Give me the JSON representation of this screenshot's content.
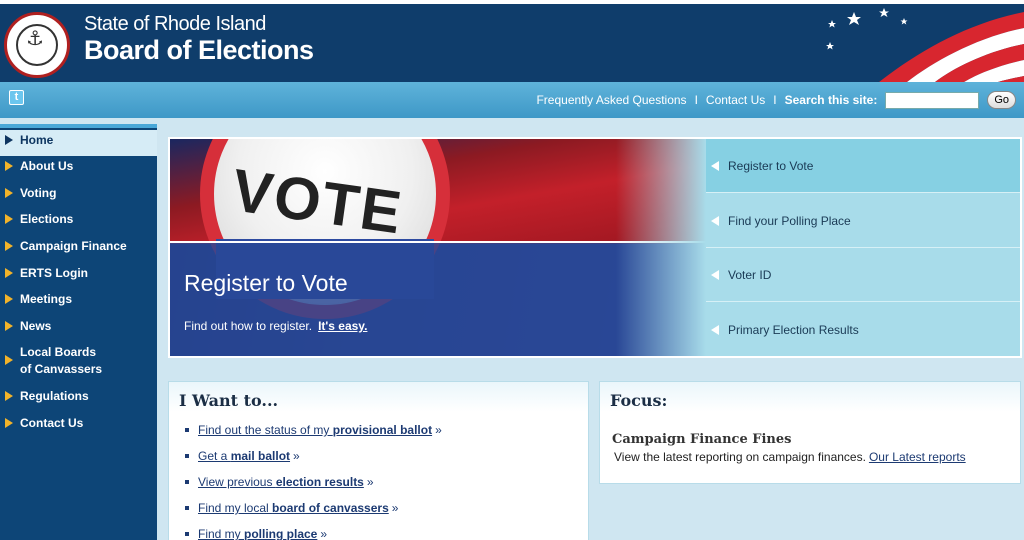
{
  "header": {
    "title_line1": "State of Rhode Island",
    "title_line2": "Board of Elections",
    "seal_icon": "state-seal-icon"
  },
  "utility_bar": {
    "twitter_icon": "twitter-icon",
    "faq_label": "Frequently Asked Questions",
    "contact_label": "Contact Us",
    "separator": "I",
    "search_label": "Search this site:",
    "search_value": "",
    "go_label": "Go"
  },
  "sidebar": {
    "items": [
      {
        "label": "Home",
        "active": true
      },
      {
        "label": "About Us"
      },
      {
        "label": "Voting"
      },
      {
        "label": "Elections"
      },
      {
        "label": "Campaign Finance"
      },
      {
        "label": "ERTS Login"
      },
      {
        "label": "Meetings"
      },
      {
        "label": "News"
      },
      {
        "label": "Local Boards of Canvassers"
      },
      {
        "label": "Regulations"
      },
      {
        "label": "Contact Us"
      }
    ]
  },
  "banner": {
    "image_word": "VOTE",
    "title": "Register to Vote",
    "subtitle": "Find out how to register.",
    "subtitle_link": "It's easy.",
    "menu": [
      {
        "label": "Register to Vote",
        "active": true
      },
      {
        "label": "Find your Polling Place"
      },
      {
        "label": "Voter ID"
      },
      {
        "label": "Primary Election Results"
      }
    ]
  },
  "i_want": {
    "heading": "I Want to...",
    "items": [
      {
        "prefix": "Find out the status of my ",
        "bold": "provisional ballot",
        "chev": "»"
      },
      {
        "prefix": "Get a ",
        "bold": "mail ballot",
        "chev": "»"
      },
      {
        "prefix": "View previous ",
        "bold": "election results",
        "chev": "»"
      },
      {
        "prefix": "Find my local ",
        "bold": "board of canvassers",
        "chev": "»"
      },
      {
        "prefix": "Find my ",
        "bold": "polling place",
        "chev": "»"
      }
    ]
  },
  "focus": {
    "heading": "Focus:",
    "title": "Campaign Finance Fines",
    "text": "View the latest reporting on campaign finances.",
    "link": "Our Latest reports"
  },
  "colors": {
    "header_bg": "#0f3d6b",
    "sidebar_bg": "#0d4577",
    "nav_arrow": "#f2b32a",
    "util_bar": "#4aa8d8",
    "banner_menu": "#a8dcea",
    "banner_menu_active": "#86d0e3"
  }
}
